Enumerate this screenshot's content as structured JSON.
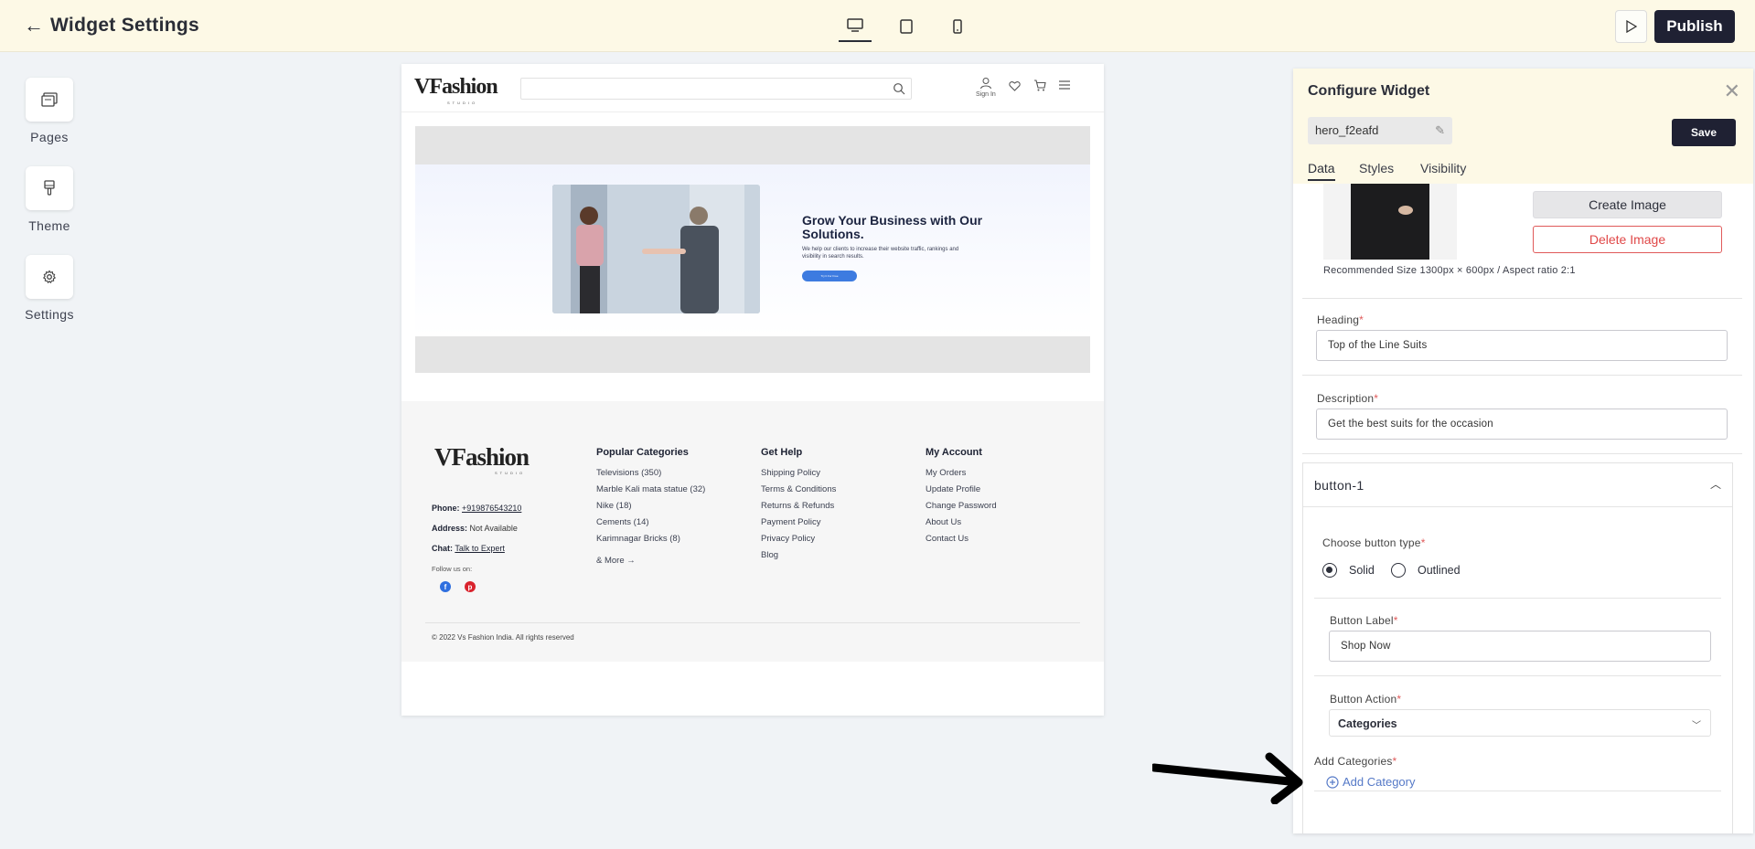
{
  "header": {
    "back_icon": "arrow-left-icon",
    "title": "Widget Settings",
    "devices": [
      "desktop-icon",
      "tablet-icon",
      "mobile-icon"
    ],
    "publish_label": "Publish"
  },
  "rail": {
    "items": [
      {
        "label": "Pages",
        "icon": "pages-icon"
      },
      {
        "label": "Theme",
        "icon": "paint-icon"
      },
      {
        "label": "Settings",
        "icon": "gear-icon"
      }
    ]
  },
  "preview": {
    "logo": "VFashion",
    "logo_sub": "STUDIO",
    "signin": "Sign In",
    "hero": {
      "heading": "Grow Your Business with Our Solutions.",
      "text": "We help our clients to increase their website traffic, rankings and visibility in search results.",
      "button": "Try It For Free"
    },
    "footer": {
      "phone_label": "Phone:",
      "phone": "+919876543210",
      "address_label": "Address:",
      "address": "Not Available",
      "chat_label": "Chat:",
      "chat": "Talk to Expert",
      "follow": "Follow us on:",
      "col1": {
        "title": "Popular Categories",
        "links": [
          "Televisions (350)",
          "Marble Kali mata statue (32)",
          "Nike (18)",
          "Cements (14)",
          "Karimnagar Bricks (8)"
        ],
        "more": "& More →"
      },
      "col2": {
        "title": "Get Help",
        "links": [
          "Shipping Policy",
          "Terms & Conditions",
          "Returns & Refunds",
          "Payment Policy",
          "Privacy Policy",
          "Blog"
        ]
      },
      "col3": {
        "title": "My Account",
        "links": [
          "My Orders",
          "Update Profile",
          "Change Password",
          "About Us",
          "Contact Us"
        ]
      },
      "copyright": "© 2022 Vs Fashion India. All rights reserved"
    }
  },
  "panel": {
    "title": "Configure Widget",
    "widget_name": "hero_f2eafd",
    "save_label": "Save",
    "tabs": [
      "Data",
      "Styles",
      "Visibility"
    ],
    "create_image": "Create Image",
    "delete_image": "Delete Image",
    "recommended": "Recommended Size 1300px × 600px / Aspect ratio 2:1",
    "heading_label": "Heading",
    "heading_value": "Top of the Line Suits",
    "description_label": "Description",
    "description_value": "Get the best suits for the occasion",
    "button_section": "button-1",
    "button_type_label": "Choose button type",
    "button_type_options": [
      "Solid",
      "Outlined"
    ],
    "button_type_selected": "Solid",
    "button_label_label": "Button Label",
    "button_label_value": "Shop Now",
    "button_action_label": "Button Action",
    "button_action_value": "Categories",
    "add_categories_label": "Add Categories",
    "add_category_link": "Add Category",
    "required_mark": "*"
  }
}
